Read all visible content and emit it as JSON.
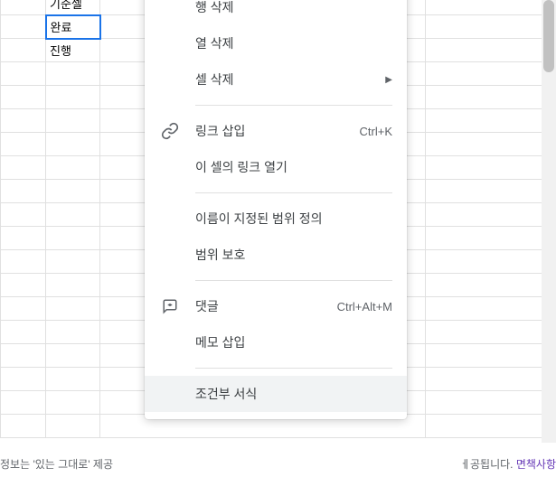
{
  "cells": {
    "a1": "기준셀",
    "a2": "완료",
    "a3": "진행"
  },
  "menu": {
    "delete_row": "행 삭제",
    "delete_col": "열 삭제",
    "delete_cell": "셀 삭제",
    "insert_link": "링크 삽입",
    "insert_link_shortcut": "Ctrl+K",
    "open_link": "이 셀의 링크 열기",
    "define_named_range": "이름이 지정된 범위 정의",
    "protect_range": "범위 보호",
    "comment": "댓글",
    "comment_shortcut": "Ctrl+Alt+M",
    "insert_note": "메모 삽입",
    "conditional_format": "조건부 서식"
  },
  "footer": {
    "left": "정보는 '있는 그대로' 제공",
    "right_text": "ㅔ공됩니다. ",
    "right_link": "면책사항"
  }
}
